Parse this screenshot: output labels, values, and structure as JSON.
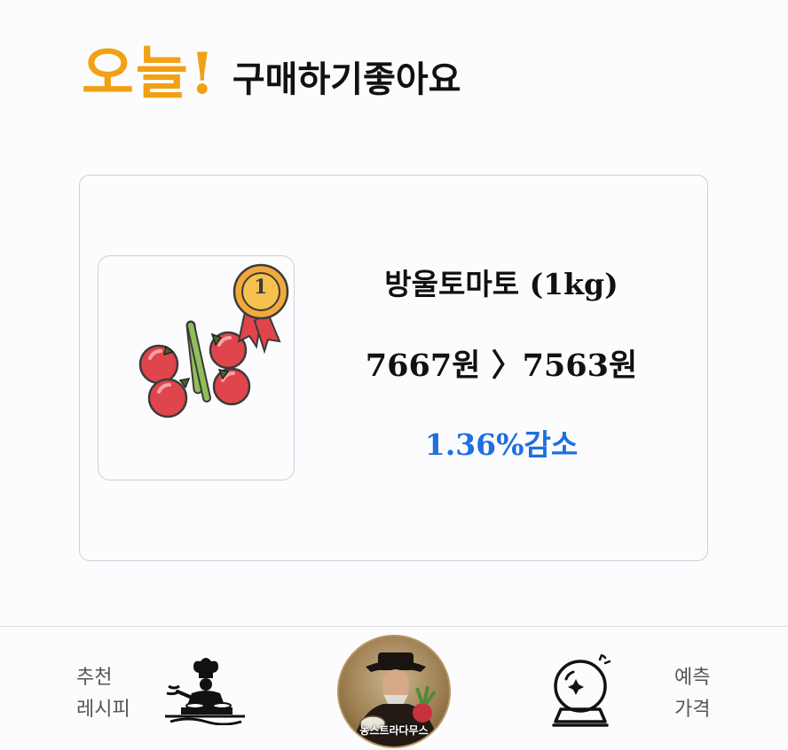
{
  "heading": {
    "accent": "오늘!",
    "text": "구매하기좋아요"
  },
  "product": {
    "name": "방울토마토 (1kg)",
    "price_change": "7667원 〉7563원",
    "rate_text": "1.36%감소",
    "rank_badge": "1",
    "rate_color": "#1e6fe0"
  },
  "nav": {
    "recipe_line1": "추천",
    "recipe_line2": "레시피",
    "predict_line1": "예측",
    "predict_line2": "가격",
    "avatar_caption": "농스트라다무스"
  },
  "colors": {
    "accent": "#f2a014",
    "tomato": "#e0454c",
    "stem": "#8fbf5a"
  }
}
